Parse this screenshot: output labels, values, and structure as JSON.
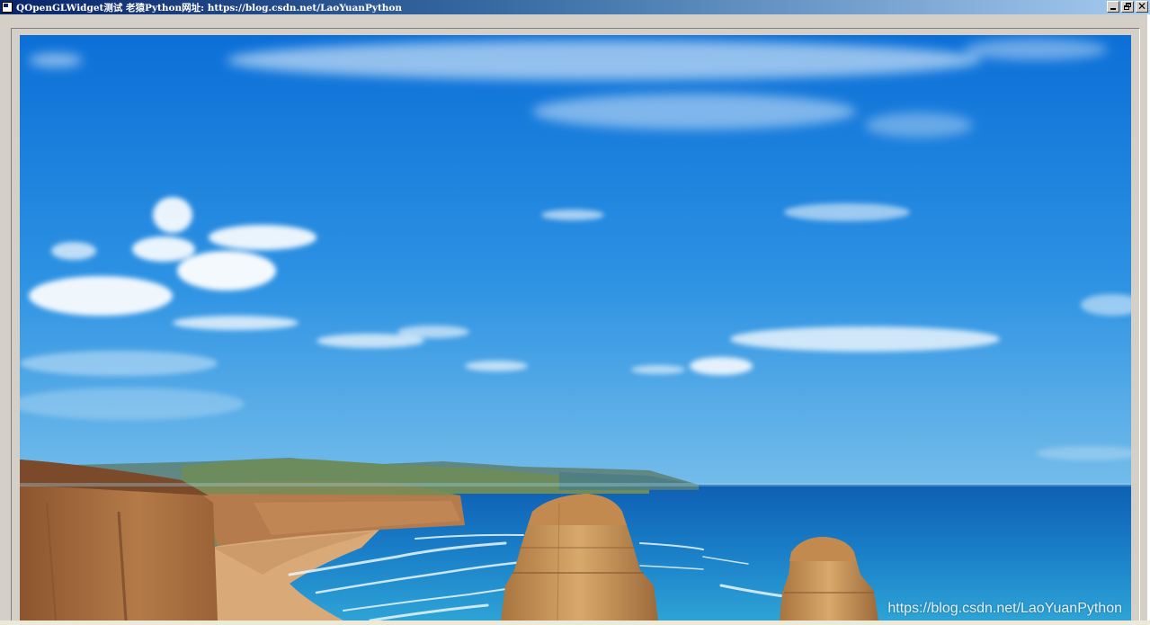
{
  "window": {
    "title": "QOpenGLWidget测试  老猿Python网址: https://blog.csdn.net/LaoYuanPython",
    "icon": "app-window-icon",
    "controls": [
      "minimize-icon",
      "restore-icon",
      "close-icon"
    ],
    "close_glyph": "✕"
  },
  "gl_widget": {
    "image_content": "coastal-cliffs-photo",
    "watermark": "https://blog.csdn.net/LaoYuanPython"
  },
  "colors": {
    "title_start": "#0a246a",
    "title_end": "#a6caf0",
    "sky_top": "#0a6fd8",
    "sky_horizon": "#6ab6ea",
    "sea": "#1576c4",
    "cliff": "#b98352",
    "frame": "#d4d0c8"
  }
}
